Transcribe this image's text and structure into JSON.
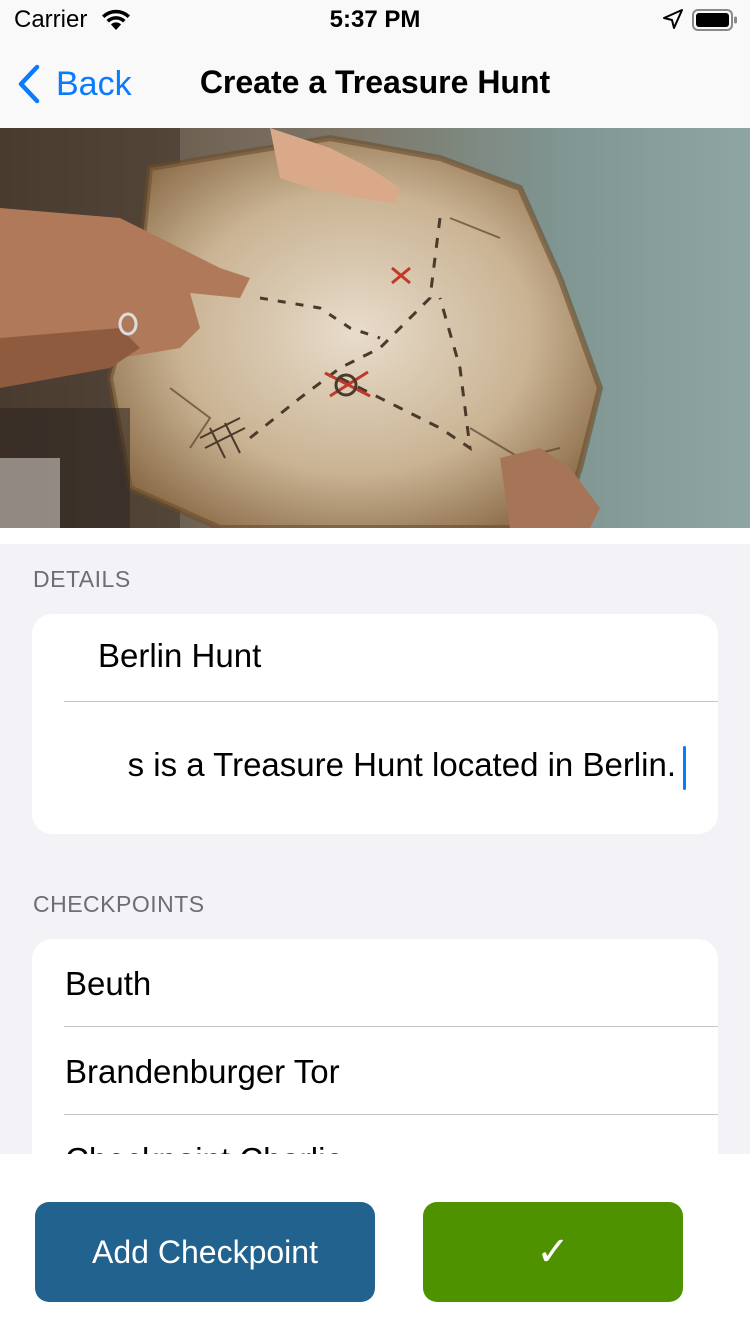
{
  "status_bar": {
    "carrier": "Carrier",
    "time": "5:37 PM",
    "wifi_icon": "wifi-icon",
    "location_icon": "location-arrow-icon",
    "battery_icon": "battery-full-icon"
  },
  "nav": {
    "back_label": "Back",
    "title": "Create a Treasure Hunt"
  },
  "hero": {
    "image": "treasure-map-photo"
  },
  "details": {
    "header": "DETAILS",
    "name_value": "Berlin Hunt",
    "description_value": "s is a Treasure Hunt located in Berlin."
  },
  "checkpoints": {
    "header": "CHECKPOINTS",
    "items": [
      "Beuth",
      "Brandenburger Tor",
      "Checkpoint Charlie"
    ]
  },
  "actions": {
    "add_checkpoint_label": "Add Checkpoint",
    "confirm_label": "✓"
  },
  "colors": {
    "accent": "#0a7aff",
    "add_button": "#22628e",
    "confirm_button": "#4f9200",
    "background": "#f2f2f7"
  }
}
